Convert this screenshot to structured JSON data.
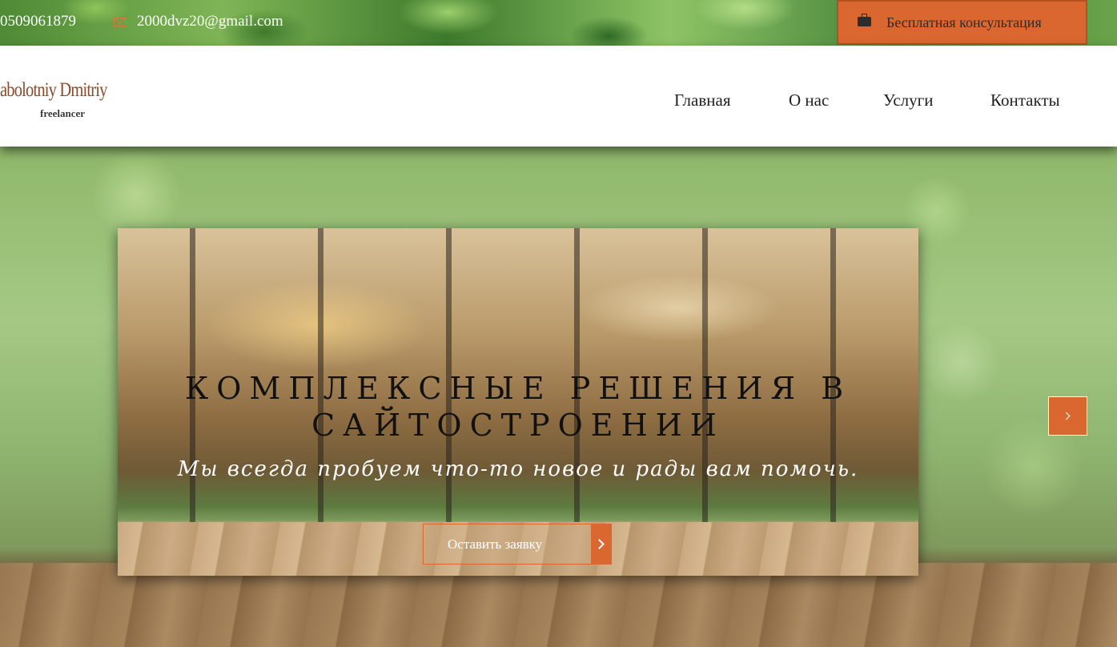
{
  "topbar": {
    "phone": "0509061879",
    "email": "2000dvz20@gmail.com",
    "consult_label": "Бесплатная консультация",
    "icons": {
      "mail": "mail-icon",
      "consult": "briefcase-icon"
    }
  },
  "header": {
    "logo_name": "abolotniy Dmitriy",
    "logo_sub": "freelancer",
    "nav": [
      {
        "label": "Главная"
      },
      {
        "label": "О нас"
      },
      {
        "label": "Услуги"
      },
      {
        "label": "Контакты"
      }
    ]
  },
  "slider": {
    "title": "Комплексные решения в сайтостроении",
    "subtitle": "Мы всегда пробуем что-то новое и рады вам помочь.",
    "cta_label": "Оставить заявку",
    "icons": {
      "cta": "chevron-right-icon",
      "next": "chevron-right-icon"
    }
  },
  "colors": {
    "accent": "#d9672f",
    "logo": "#8a4b2c",
    "nav_text": "#1f1f1f"
  }
}
